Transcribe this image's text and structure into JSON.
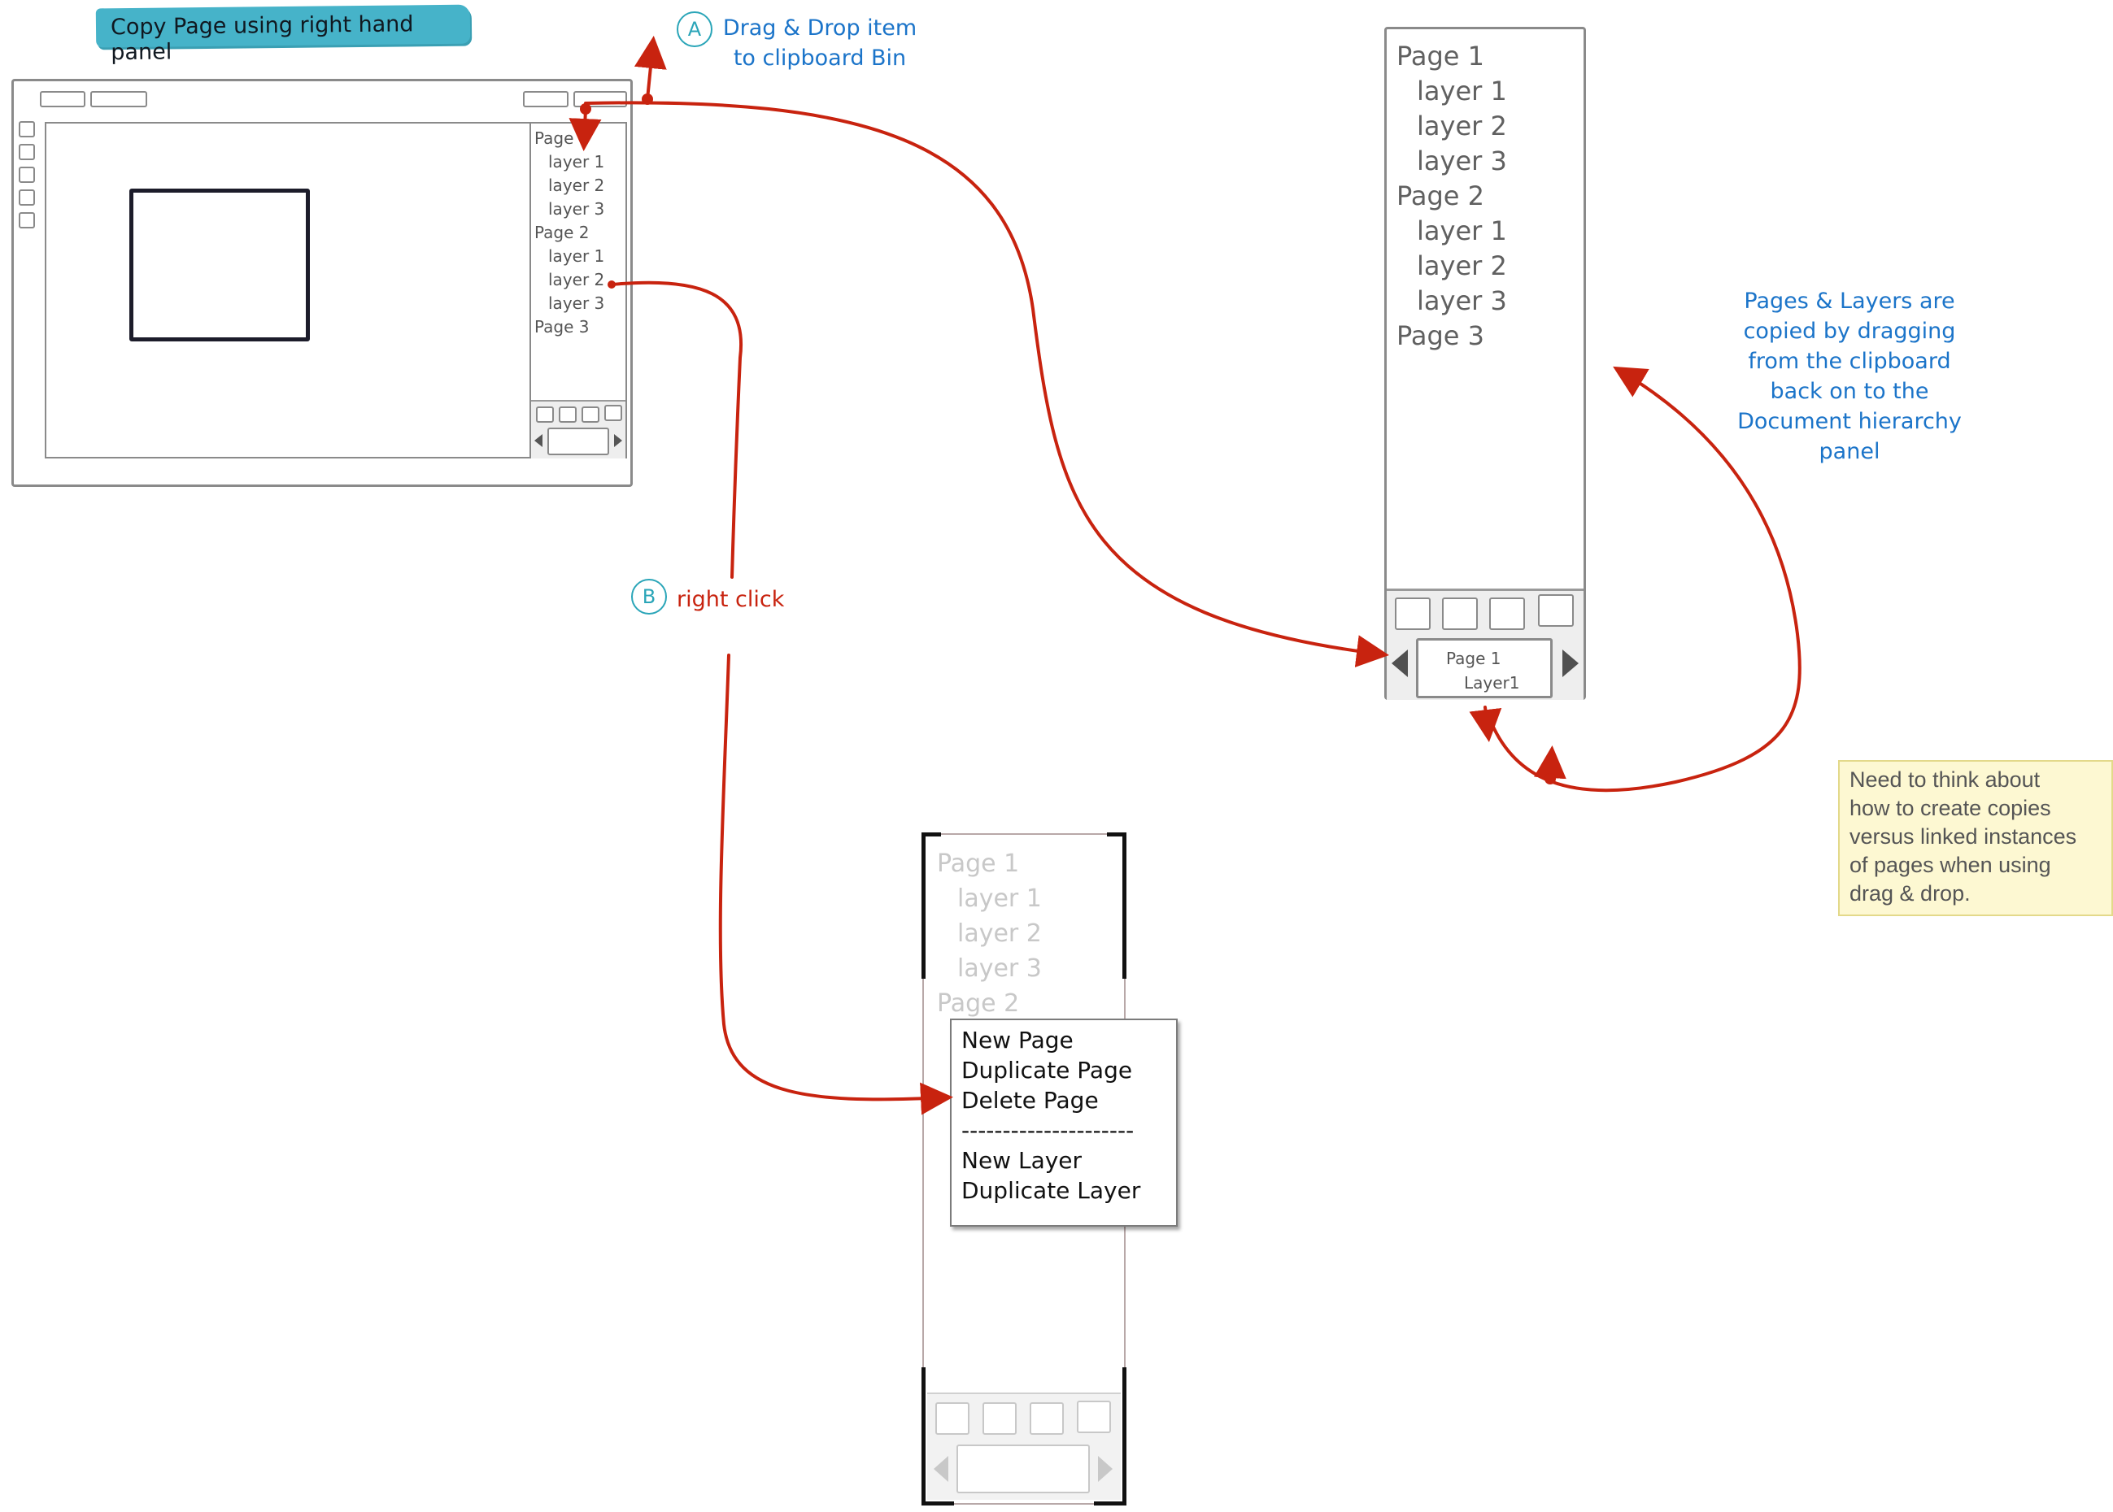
{
  "title": "Copy Page using right hand panel",
  "step_a": {
    "marker": "A",
    "text": [
      "Drag & Drop item",
      "to clipboard Bin"
    ]
  },
  "step_b": {
    "marker": "B",
    "text": "right click"
  },
  "app_panel": {
    "items": [
      {
        "label": "Page 1",
        "level": 0
      },
      {
        "label": "layer 1",
        "level": 1
      },
      {
        "label": "layer 2",
        "level": 1
      },
      {
        "label": "layer 3",
        "level": 1
      },
      {
        "label": "Page 2",
        "level": 0
      },
      {
        "label": "layer 1",
        "level": 1
      },
      {
        "label": "layer 2",
        "level": 1
      },
      {
        "label": "layer 3",
        "level": 1
      },
      {
        "label": "Page 3",
        "level": 0
      }
    ]
  },
  "clipboard_panel": {
    "items": [
      {
        "label": "Page 1",
        "level": 0
      },
      {
        "label": "layer 1",
        "level": 1
      },
      {
        "label": "layer 2",
        "level": 1
      },
      {
        "label": "layer 3",
        "level": 1
      },
      {
        "label": "Page 2",
        "level": 0
      },
      {
        "label": "layer 1",
        "level": 1
      },
      {
        "label": "layer 2",
        "level": 1
      },
      {
        "label": "layer 3",
        "level": 1
      },
      {
        "label": "Page 3",
        "level": 0
      }
    ],
    "bin": {
      "line1": "Page 1",
      "line2": "Layer1"
    }
  },
  "context_panel": {
    "items": [
      {
        "label": "Page 1",
        "level": 0
      },
      {
        "label": "layer 1",
        "level": 1
      },
      {
        "label": "layer 2",
        "level": 1
      },
      {
        "label": "layer 3",
        "level": 1
      },
      {
        "label": "Page 2",
        "level": 0
      }
    ],
    "menu": [
      "New Page",
      "Duplicate Page",
      "Delete Page",
      "---------------------",
      "New Layer",
      "Duplicate Layer"
    ]
  },
  "note_blue": [
    "Pages & Layers are",
    "copied by dragging",
    "from the clipboard",
    "back on to the",
    "Document  hierarchy",
    "panel"
  ],
  "note_sticky": [
    "Need to think about",
    "how to create copies",
    "versus linked instances",
    "of pages when using",
    "drag & drop."
  ],
  "colors": {
    "arrow": "#c8230f",
    "blue_text": "#1b74c9",
    "teal": "#46b3c9",
    "sticky": "#fdf8d2"
  }
}
